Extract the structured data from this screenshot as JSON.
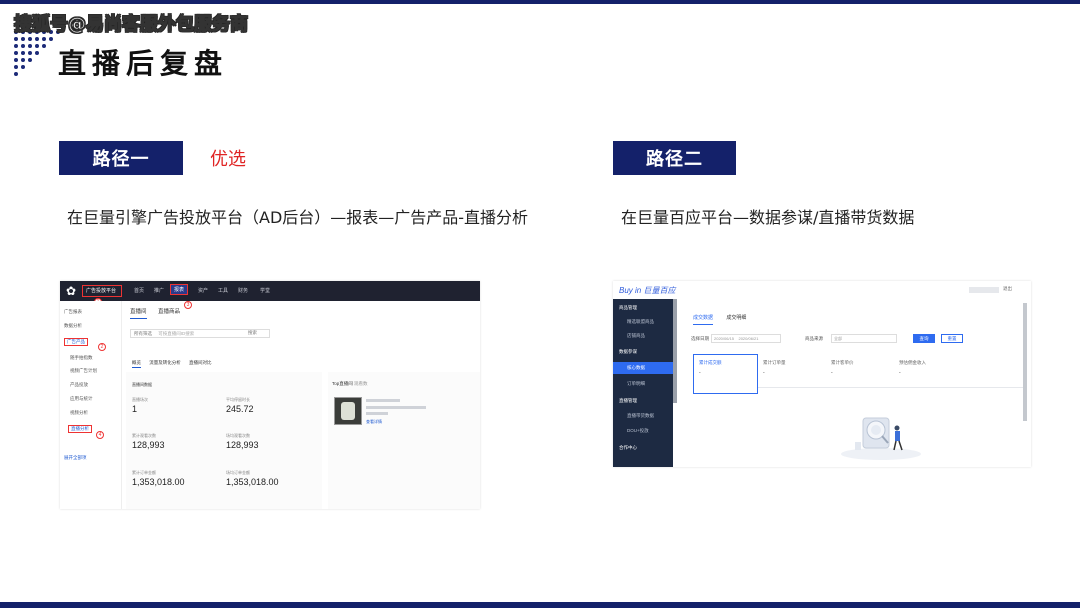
{
  "watermark": "搜狐号@易尚客服外包服务商",
  "title": "直播后复盘",
  "route1": {
    "label": "路径一",
    "tag": "优选",
    "description": "在巨量引擎广告投放平台（AD后台）—报表—广告产品-直播分析",
    "screenshot": {
      "brand": "广告投放平台",
      "nav": [
        "首页",
        "推广",
        "报表",
        "资产",
        "工具",
        "财务",
        "学堂"
      ],
      "active_nav": "报表",
      "markers": [
        "1",
        "2",
        "3",
        "4"
      ],
      "sidebar": [
        "广告报表",
        "数据分析",
        "广告产品",
        "随手拍指数",
        "视频广告计划",
        "产品投放",
        "应用与统计",
        "视频分析",
        "直播分析",
        "展开全部项"
      ],
      "tabs": [
        "直播间",
        "直播商品"
      ],
      "filter_placeholder": "所有筛选",
      "filter_search": "可按直播间ID搜索",
      "search_btn": "搜索",
      "subtabs": [
        "概览",
        "流量及转化分析",
        "直播间对比"
      ],
      "section_title": "直播间数据",
      "metrics": [
        {
          "label": "直播场次",
          "value": "1"
        },
        {
          "label": "平均停留时长",
          "value": "245.72"
        },
        {
          "label": "累计观看次数",
          "value": "128,993"
        },
        {
          "label": "场均观看次数",
          "value": "128,993"
        },
        {
          "label": "累计订单金额",
          "value": "1,353,018.00"
        },
        {
          "label": "场均订单金额",
          "value": "1,353,018.00"
        }
      ],
      "top_title": "Top直播间",
      "top_filter": "观看数",
      "top_link": "查看详情"
    }
  },
  "route2": {
    "label": "路径二",
    "description": "在巨量百应平台—数据参谋/直播带货数据",
    "screenshot": {
      "logo": "Buy in 巨量百应",
      "exit": "退出",
      "sidebar": [
        "商品管理",
        "精选联盟商品",
        "店铺商品",
        "数据参谋",
        "核心数据",
        "订单明细",
        "直播管理",
        "直播带货数据",
        "DOU+投放",
        "合作中心"
      ],
      "tabs": [
        "成交数据",
        "成交明细"
      ],
      "form_labels": [
        "选择日期",
        "商品来源"
      ],
      "date_start": "2020/06/15",
      "date_end": "2020/06/21",
      "source": "全部",
      "query_btn": "查询",
      "export_btn": "重置",
      "metrics": [
        "累计成交额",
        "累计订单量",
        "累计客单价",
        "预估佣金收入"
      ],
      "metric_value": "-"
    }
  },
  "colors": {
    "navy": "#14216a",
    "red": "#e02424",
    "blue": "#2e6bf0"
  }
}
